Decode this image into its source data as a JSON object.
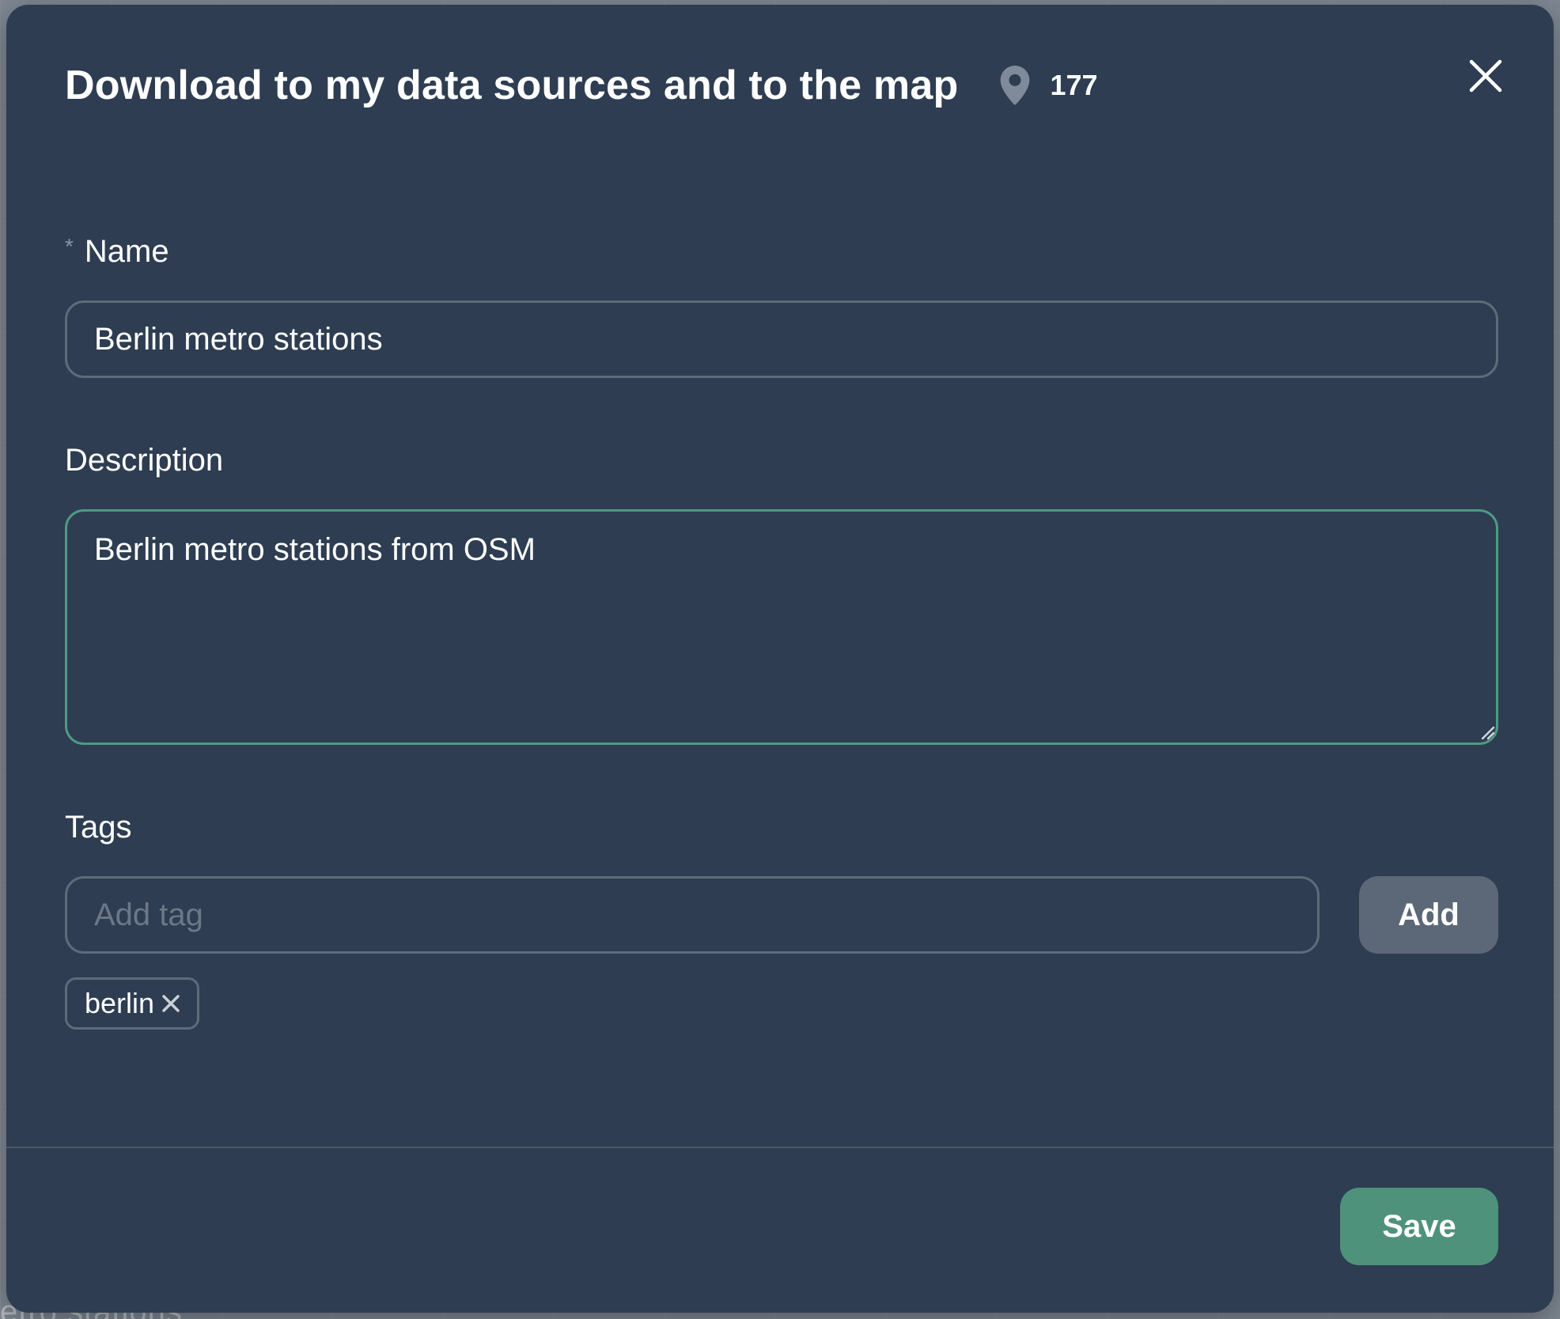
{
  "background": {
    "map_caption": "etro stations"
  },
  "modal": {
    "title": "Download to my data sources and to the map",
    "count": "177",
    "count_icon": "map-pin-icon",
    "close_icon": "close-icon"
  },
  "form": {
    "name": {
      "required_mark": "*",
      "label": "Name",
      "value": "Berlin metro stations"
    },
    "description": {
      "label": "Description",
      "value": "Berlin metro stations from OSM"
    },
    "tags": {
      "label": "Tags",
      "placeholder": "Add tag",
      "add_label": "Add",
      "items": [
        {
          "label": "berlin",
          "remove_icon": "close-icon"
        }
      ]
    }
  },
  "footer": {
    "save_label": "Save"
  },
  "colors": {
    "modal_bg": "#2e3d51",
    "accent_green": "#4f927b",
    "focus_border": "#4f9a83",
    "input_border": "#5e6b7b",
    "secondary_button": "#5c6877"
  }
}
